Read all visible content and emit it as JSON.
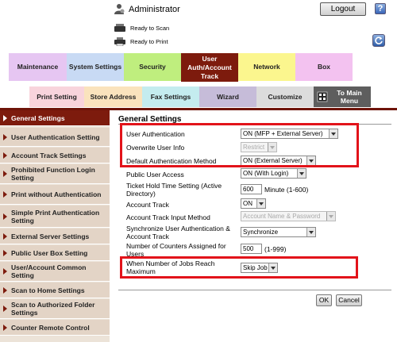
{
  "header": {
    "user_label": "Administrator",
    "logout_label": "Logout",
    "help_label": "?",
    "status": [
      {
        "label": "Ready to Scan",
        "icon": "scanner-icon"
      },
      {
        "label": "Ready to Print",
        "icon": "printer-icon"
      }
    ]
  },
  "tabs_row1": [
    {
      "label": "Maintenance",
      "color": "#e6c6f2"
    },
    {
      "label": "System Settings",
      "color": "#c8daf4"
    },
    {
      "label": "Security",
      "color": "#bfee7e"
    },
    {
      "label": "User Auth/Account Track",
      "color": "#7d1b0d",
      "active": true
    },
    {
      "label": "Network",
      "color": "#fbf68e"
    },
    {
      "label": "Box",
      "color": "#f3c2f0"
    }
  ],
  "tabs_row2": [
    {
      "label": "Print Setting",
      "color": "#f8d4dc"
    },
    {
      "label": "Store Address",
      "color": "#fae3bd"
    },
    {
      "label": "Fax Settings",
      "color": "#c4ecef"
    },
    {
      "label": "Wizard",
      "color": "#c6bcd9"
    },
    {
      "label": "Customize",
      "color": "#dcdcdc"
    },
    {
      "label": "To Main Menu",
      "color": "#5e5e5e"
    }
  ],
  "sidebar": {
    "items": [
      {
        "label": "General Settings",
        "active": true
      },
      {
        "label": "User Authentication Setting"
      },
      {
        "label": "Account Track Settings"
      },
      {
        "label": "Prohibited Function Login Setting"
      },
      {
        "label": "Print without Authentication"
      },
      {
        "label": "Simple Print Authentication Setting"
      },
      {
        "label": "External Server Settings"
      },
      {
        "label": "Public User Box Setting"
      },
      {
        "label": "User/Account Common Setting"
      },
      {
        "label": "Scan to Home Settings"
      },
      {
        "label": "Scan to Authorized Folder Settings"
      },
      {
        "label": "Counter Remote Control"
      }
    ]
  },
  "main": {
    "title": "General Settings",
    "fields": {
      "user_auth": {
        "label": "User Authentication",
        "value": "ON (MFP + External Server)"
      },
      "overwrite": {
        "label": "Overwrite User Info",
        "value": "Restrict"
      },
      "default_auth": {
        "label": "Default Authentication Method",
        "value": "ON (External Server)"
      },
      "public_user": {
        "label": "Public User Access",
        "value": "ON (With Login)"
      },
      "ticket_hold": {
        "label": "Ticket Hold Time Setting (Active Directory)",
        "value": "600",
        "unit": "Minute (1-600)"
      },
      "account_track": {
        "label": "Account Track",
        "value": "ON"
      },
      "account_input": {
        "label": "Account Track Input Method",
        "value": "Account Name & Password"
      },
      "synchronize": {
        "label": "Synchronize User Authentication & Account Track",
        "value": "Synchronize"
      },
      "counters": {
        "label": "Number of Counters Assigned for Users",
        "value": "500",
        "unit": "(1-999)"
      },
      "jobs_max": {
        "label": "When Number of Jobs Reach Maximum",
        "value": "Skip Job"
      }
    },
    "ok_label": "OK",
    "cancel_label": "Cancel"
  },
  "colors": {
    "accent": "#7d1b0d",
    "highlight": "#e2131a"
  }
}
